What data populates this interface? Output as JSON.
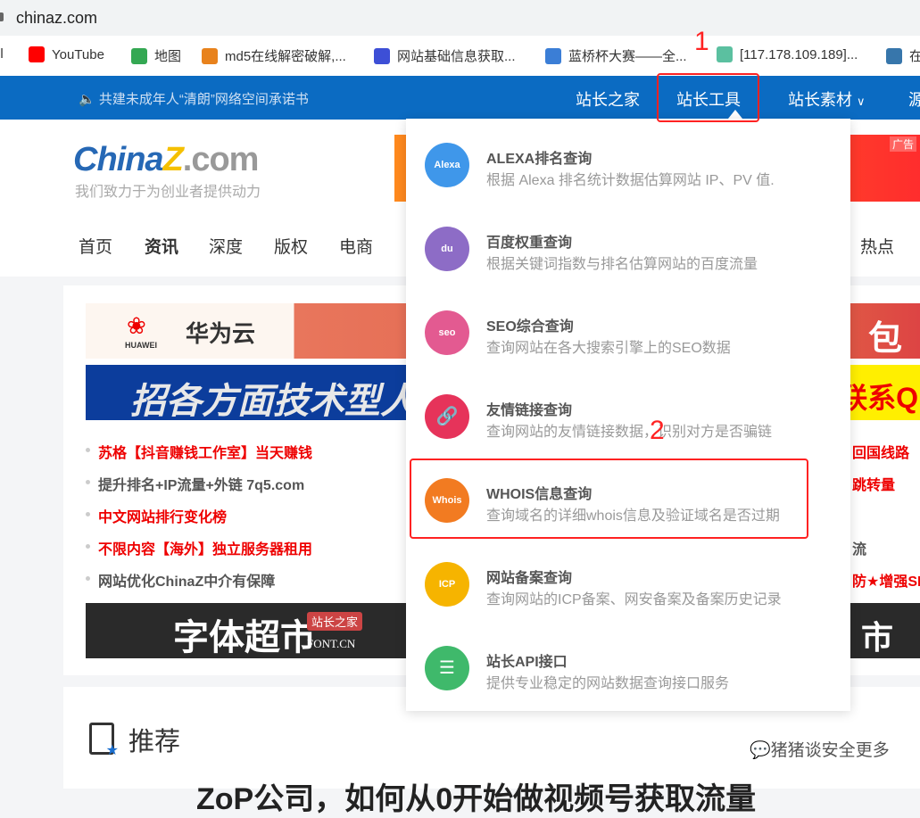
{
  "browser": {
    "url": "chinaz.com",
    "bookmarks": [
      {
        "label": "il",
        "icon": "gmail-icon"
      },
      {
        "label": "YouTube",
        "icon": "youtube-icon",
        "color": "#ff0000"
      },
      {
        "label": "地图",
        "icon": "maps-icon",
        "color": "#34a853"
      },
      {
        "label": "md5在线解密破解,...",
        "icon": "md5-icon",
        "color": "#e8821c"
      },
      {
        "label": "网站基础信息获取...",
        "icon": "ts-icon",
        "color": "#3d4fd6"
      },
      {
        "label": "蓝桥杯大赛——全...",
        "icon": "lanqiao-icon",
        "color": "#3b7ed6"
      },
      {
        "label": "[117.178.109.189]...",
        "icon": "gear-flower-icon",
        "color": "#5bc0a0"
      },
      {
        "label": "在",
        "icon": "python-icon",
        "color": "#3776ab"
      }
    ]
  },
  "topnav": {
    "notice": "共建未成年人“清朗”网络空间承诺书",
    "items": [
      "站长之家",
      "站长工具",
      "站长素材",
      "源"
    ]
  },
  "logo": {
    "main": "China",
    "z": "Z",
    ".com": ".com",
    "slogan": "我们致力于为创业者提供动力"
  },
  "ad_label": "广告",
  "channel_nav": [
    "首页",
    "资讯",
    "深度",
    "版权",
    "电商",
    "热点"
  ],
  "banners": {
    "huawei": "华为云",
    "huawei_en": "HUAWEI",
    "recruit": "招各方面技术型人",
    "font": "字体超市",
    "font_tag": "站长之家",
    "font_url": "FONT.CN",
    "right1": "包",
    "right2": "联系Q",
    "right3": "市"
  },
  "links": [
    {
      "text": "苏格【抖音赚钱工作室】当天赚钱",
      "hot": true
    },
    {
      "text": "提升排名+IP流量+外链 7q5.com",
      "hot": false
    },
    {
      "text": "中文网站排行变化榜",
      "hot": true
    },
    {
      "text": "不限内容【海外】独立服务器租用",
      "hot": true
    },
    {
      "text": "网站优化ChinaZ中介有保障",
      "hot": false
    }
  ],
  "right_links": [
    "回国线路",
    "跳转量",
    "",
    "流",
    "防★增强SE"
  ],
  "dropdown": [
    {
      "title": "ALEXA排名查询",
      "desc": "根据 Alexa 排名统计数据估算网站 IP、PV 值.",
      "icon": "alexa-icon",
      "glyph": "Alexa",
      "color": "#3f97ea"
    },
    {
      "title": "百度权重查询",
      "desc": "根据关键词指数与排名估算网站的百度流量",
      "icon": "baidu-paw-icon",
      "glyph": "du",
      "color": "#8d6cc6"
    },
    {
      "title": "SEO综合查询",
      "desc": "查询网站在各大搜索引擎上的SEO数据",
      "icon": "seo-icon",
      "glyph": "seo",
      "color": "#e35a91"
    },
    {
      "title": "友情链接查询",
      "desc": "查询网站的友情链接数据，识别对方是否骗链",
      "icon": "link-icon",
      "glyph": "🔗",
      "color": "#e6335a"
    },
    {
      "title": "WHOIS信息查询",
      "desc": "查询域名的详细whois信息及验证域名是否过期",
      "icon": "whois-icon",
      "glyph": "Whois",
      "color": "#f27b21"
    },
    {
      "title": "网站备案查询",
      "desc": "查询网站的ICP备案、网安备案及备案历史记录",
      "icon": "icp-icon",
      "glyph": "ICP",
      "color": "#f6b400"
    },
    {
      "title": "站长API接口",
      "desc": "提供专业稳定的网站数据查询接口服务",
      "icon": "api-sliders-icon",
      "glyph": "☰",
      "color": "#3fb96b"
    }
  ],
  "recommend": {
    "title": "推荐",
    "headline": "ZoP公司，如何从0开始做视频号获取流量"
  },
  "watermark": "猪猪谈安全",
  "watermark_more": "更多",
  "annotations": [
    "1",
    "2"
  ]
}
